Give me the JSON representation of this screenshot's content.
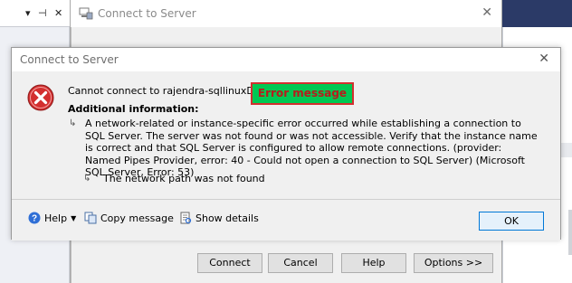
{
  "ide": {
    "toolbar_glyphs": [
      "▾",
      "⊣",
      "✕"
    ]
  },
  "background_window": {
    "title": "Connect to Server",
    "buttons": [
      "Connect",
      "Cancel",
      "Help",
      "Options >>"
    ]
  },
  "error_dialog": {
    "title": "Connect to Server",
    "message": "Cannot connect to rajendra-sqllinuxDemo.",
    "callout_label": "Error message",
    "additional_info_heading": "Additional information:",
    "detail_text": "A network-related or instance-specific error occurred while establishing a connection to SQL Server. The server was not found or was not accessible. Verify that the instance name is correct and that SQL Server is configured to allow remote connections. (provider: Named Pipes Provider, error: 40 - Could not open a connection to SQL Server) (Microsoft SQL Server, Error: 53)",
    "sub_detail": "The network path was not found",
    "footer": {
      "help_label": "Help",
      "copy_label": "Copy message",
      "details_label": "Show details",
      "ok_label": "OK"
    }
  },
  "icons": {
    "error": "error-x-icon",
    "help": "help-icon",
    "copy": "copy-icon",
    "details": "details-icon"
  },
  "colors": {
    "callout_bg": "#00c853",
    "callout_border": "#d32f2f",
    "callout_text": "#b71c1c",
    "error_icon": "#d32f2f",
    "ide_accent": "#2b3a67"
  }
}
